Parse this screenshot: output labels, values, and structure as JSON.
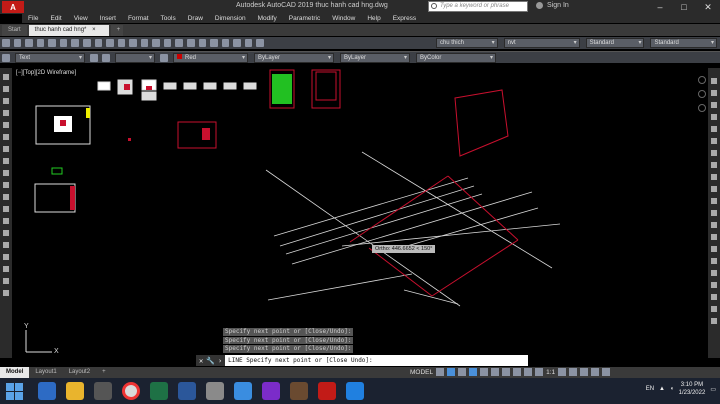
{
  "titlebar": {
    "app_icon": "A",
    "title": "Autodesk AutoCAD 2019   thuc hanh cad hng.dwg",
    "search_placeholder": "Type a keyword or phrase",
    "signin": "Sign In"
  },
  "menu": [
    "File",
    "Edit",
    "View",
    "Insert",
    "Format",
    "Tools",
    "Draw",
    "Dimension",
    "Modify",
    "Parametric",
    "Window",
    "Help",
    "Express"
  ],
  "tabs": {
    "start": "Start",
    "drawing": "thuc hanh cad hng*"
  },
  "toolbar1": {
    "layer": "chu thich",
    "dimstyle": "nvt",
    "textstyle1": "Standard",
    "textstyle2": "Standard"
  },
  "toolbar2": {
    "text_combo": "Text",
    "color": "Red",
    "linetype": "ByLayer",
    "lineweight": "ByLayer",
    "plotstyle": "ByColor"
  },
  "viewport_label": "[−][Top][2D Wireframe]",
  "ortho_tooltip": "Ortho: 446.6652 < 150°",
  "command_history": [
    "Specify next point or [Close/Undo]:",
    "Specify next point or [Close/Undo]:",
    "Specify next point or [Close/Undo]:"
  ],
  "command_line": "LINE Specify next point or [Close Undo]:",
  "layout_tabs": [
    "Model",
    "Layout1",
    "Layout2"
  ],
  "status": {
    "model": "MODEL",
    "scale": "1:1"
  },
  "tray": {
    "lang": "EN",
    "time": "3:10 PM",
    "date": "1/23/2022"
  },
  "taskbar_apps": [
    "file-explorer-icon",
    "chrome-icon",
    "excel-icon",
    "word-icon",
    "zalo-icon",
    "autocad-icon"
  ],
  "colors": {
    "accent_red": "#c21b17",
    "drawing_red": "#c8102e",
    "line_white": "#d8d8d8"
  }
}
